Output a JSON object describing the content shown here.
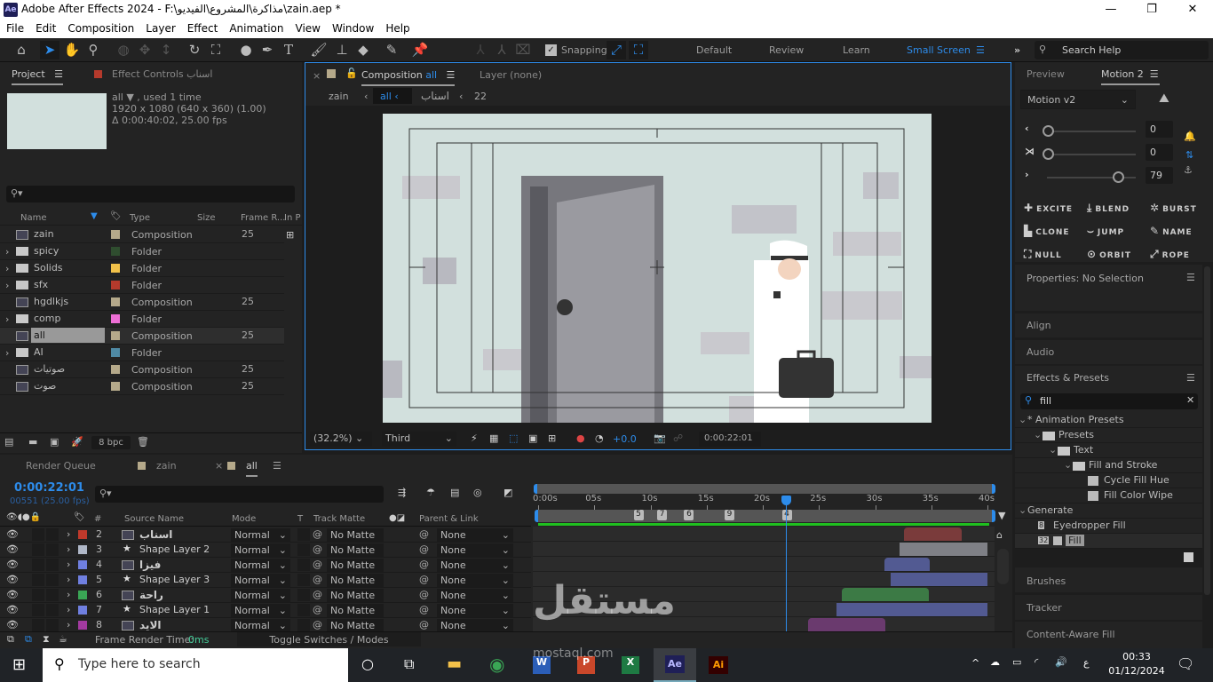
{
  "app": {
    "title": "Adobe After Effects 2024 - F:\\مذاكرة\\المشروع\\الفيديو\\zain.aep *",
    "logo": "Ae"
  },
  "menu": [
    "File",
    "Edit",
    "Composition",
    "Layer",
    "Effect",
    "Animation",
    "View",
    "Window",
    "Help"
  ],
  "toolbar": {
    "snapping_label": "Snapping",
    "snapping_checked": true,
    "workspaces": [
      "Default",
      "Review",
      "Learn",
      "Small Screen"
    ],
    "active_workspace": "Small Screen",
    "search_placeholder": "Search Help"
  },
  "project": {
    "tab": "Project",
    "effect_controls_tab": "Effect Controls اسناب",
    "selected_name": "all ▼ , used 1 time",
    "resolution": "1920 x 1080  (640 x 360) (1.00)",
    "duration": "Δ 0:00:40:02, 25.00 fps",
    "columns": [
      "Name",
      "Type",
      "Size",
      "Frame R...",
      "In P"
    ],
    "items": [
      {
        "name": "zain",
        "type": "Composition",
        "fps": "25",
        "kind": "comp",
        "color": "#b5a98a",
        "expand": false
      },
      {
        "name": "spicy",
        "type": "Folder",
        "fps": "",
        "kind": "folder",
        "color": "#2f4d2f",
        "expand": true
      },
      {
        "name": "Solids",
        "type": "Folder",
        "fps": "",
        "kind": "folder",
        "color": "#f2c24a",
        "expand": true
      },
      {
        "name": "sfx",
        "type": "Folder",
        "fps": "",
        "kind": "folder",
        "color": "#b53a2c",
        "expand": true
      },
      {
        "name": "hgdlkjs",
        "type": "Composition",
        "fps": "25",
        "kind": "comp",
        "color": "#b5a98a",
        "expand": false
      },
      {
        "name": "comp",
        "type": "Folder",
        "fps": "",
        "kind": "folder",
        "color": "#ee6fd5",
        "expand": true
      },
      {
        "name": "all",
        "type": "Composition",
        "fps": "25",
        "kind": "comp",
        "color": "#b5a98a",
        "expand": false,
        "selected": true
      },
      {
        "name": "AI",
        "type": "Folder",
        "fps": "",
        "kind": "folder",
        "color": "#4f8aa5",
        "expand": true
      },
      {
        "name": "صوتيات",
        "type": "Composition",
        "fps": "25",
        "kind": "comp",
        "color": "#b5a98a",
        "expand": false
      },
      {
        "name": "صوت",
        "type": "Composition",
        "fps": "25",
        "kind": "comp",
        "color": "#b5a98a",
        "expand": false
      }
    ],
    "bpc": "8 bpc"
  },
  "composition": {
    "tab_prefix": "Composition",
    "tab_name": "all",
    "layer_tab": "Layer (none)",
    "breadcrumb": [
      "zain",
      "all",
      "اسناب",
      "22"
    ],
    "zoom": "(32.2%)",
    "resolution": "Third",
    "exposure": "+0.0",
    "timecode": "0:00:22:01"
  },
  "timeline": {
    "tabs": [
      "Render Queue",
      "zain",
      "all"
    ],
    "active_tab": "all",
    "timecode": "0:00:22:01",
    "frame_info": "00551 (25.00 fps)",
    "columns": {
      "source": "Source Name",
      "mode": "Mode",
      "t": "T",
      "track_matte": "Track Matte",
      "parent": "Parent & Link",
      "num": "#"
    },
    "ruler": [
      "0:00s",
      "05s",
      "10s",
      "15s",
      "20s",
      "25s",
      "30s",
      "35s",
      "40s"
    ],
    "duration_s": 40,
    "current_time_s": 22.04,
    "markers": [
      {
        "label": "5",
        "time_s": 8.5
      },
      {
        "label": "7",
        "time_s": 10.6
      },
      {
        "label": "6",
        "time_s": 13.0
      },
      {
        "label": "9",
        "time_s": 16.6
      },
      {
        "label": "4",
        "time_s": 21.7
      }
    ],
    "layers": [
      {
        "num": "2",
        "name": "اسناب",
        "kind": "comp",
        "label_color": "#c0392b",
        "mode": "Normal",
        "matte": "No Matte",
        "parent": "None",
        "in_s": 32.6,
        "out_s": 37.7,
        "bar_color": "#7a3b3b"
      },
      {
        "num": "3",
        "name": "Shape Layer 2",
        "kind": "shape",
        "label_color": "#b0b8c8",
        "mode": "Normal",
        "matte": "No Matte",
        "parent": "None",
        "in_s": 32.2,
        "out_s": 40,
        "bar_color": "#7f8086"
      },
      {
        "num": "4",
        "name": "فيزا",
        "kind": "comp",
        "label_color": "#6f7fe0",
        "mode": "Normal",
        "matte": "No Matte",
        "parent": "None",
        "in_s": 30.8,
        "out_s": 34.9,
        "bar_color": "#525a92"
      },
      {
        "num": "5",
        "name": "Shape Layer 3",
        "kind": "shape",
        "label_color": "#6f7fe0",
        "mode": "Normal",
        "matte": "No Matte",
        "parent": "None",
        "in_s": 31.4,
        "out_s": 40,
        "bar_color": "#525a92"
      },
      {
        "num": "6",
        "name": "راحة",
        "kind": "comp",
        "label_color": "#3aa655",
        "mode": "Normal",
        "matte": "No Matte",
        "parent": "None",
        "in_s": 27.0,
        "out_s": 34.8,
        "bar_color": "#3c7a45"
      },
      {
        "num": "7",
        "name": "Shape Layer 1",
        "kind": "shape",
        "label_color": "#6f7fe0",
        "mode": "Normal",
        "matte": "No Matte",
        "parent": "None",
        "in_s": 26.6,
        "out_s": 40,
        "bar_color": "#525a92"
      },
      {
        "num": "8",
        "name": "الايد",
        "kind": "comp",
        "label_color": "#a33aa0",
        "mode": "Normal",
        "matte": "No Matte",
        "parent": "None",
        "in_s": 24.0,
        "out_s": 30.9,
        "bar_color": "#6a3a6e"
      }
    ],
    "frame_render_label": "Frame Render Time:",
    "frame_render_value": "0ms",
    "toggle_label": "Toggle Switches / Modes"
  },
  "right": {
    "tabs": [
      "Preview",
      "Motion 2"
    ],
    "motion_version": "Motion v2",
    "sliders": [
      {
        "value": "0",
        "fraction": 0
      },
      {
        "value": "0",
        "fraction": 0
      },
      {
        "value": "79",
        "fraction": 0.79
      }
    ],
    "motion_buttons": [
      [
        "EXCITE",
        "BLEND",
        "BURST"
      ],
      [
        "CLONE",
        "JUMP",
        "NAME"
      ],
      [
        "NULL",
        "ORBIT",
        "ROPE"
      ]
    ],
    "properties": "Properties: No Selection",
    "align": "Align",
    "audio": "Audio",
    "effects_presets": "Effects & Presets",
    "search_value": "fill",
    "tree": [
      {
        "label": "* Animation Presets",
        "level": 0,
        "kind": "group"
      },
      {
        "label": "Presets",
        "level": 1,
        "kind": "folder"
      },
      {
        "label": "Text",
        "level": 2,
        "kind": "folder"
      },
      {
        "label": "Fill and Stroke",
        "level": 3,
        "kind": "folder"
      },
      {
        "label": "Cycle Fill Hue",
        "level": 4,
        "kind": "preset"
      },
      {
        "label": "Fill Color Wipe",
        "level": 4,
        "kind": "preset"
      },
      {
        "label": "Generate",
        "level": 0,
        "kind": "group"
      },
      {
        "label": "Eyedropper Fill",
        "level": 1,
        "kind": "effect",
        "badge": "8"
      },
      {
        "label": "Fill",
        "level": 1,
        "kind": "effect",
        "badge": "32",
        "selected": true
      }
    ],
    "brushes": "Brushes",
    "tracker": "Tracker",
    "content_aware": "Content-Aware Fill"
  },
  "taskbar": {
    "search_placeholder": "Type here to search",
    "time": "00:33",
    "date": "01/12/2024",
    "lang": "ع",
    "apps": [
      "Task View",
      "File Explorer",
      "Chrome",
      "Word",
      "PowerPoint",
      "Excel",
      "After Effects",
      "Illustrator"
    ]
  },
  "watermark": {
    "text": "مستقل",
    "sub": "mostaql.com"
  },
  "colors": {
    "accent": "#2d8ceb",
    "panel": "#232323",
    "timecode": "#2d8ceb",
    "work_area": "#1fbf1f"
  }
}
